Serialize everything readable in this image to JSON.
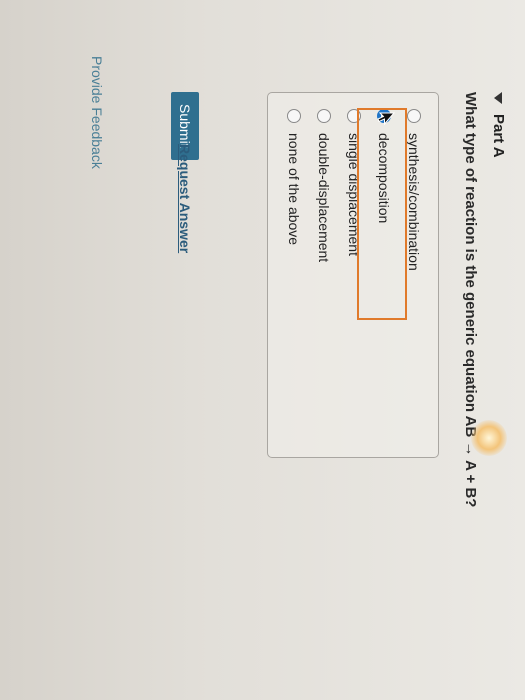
{
  "part": {
    "title": "Part A"
  },
  "question": {
    "text": "What type of reaction is the generic equation AB → A + B?"
  },
  "options": [
    {
      "label": "synthesis/combination",
      "selected": false
    },
    {
      "label": "decomposition",
      "selected": true
    },
    {
      "label": "single displacement",
      "selected": false
    },
    {
      "label": "double-displacement",
      "selected": false
    },
    {
      "label": "none of the above",
      "selected": false
    }
  ],
  "actions": {
    "submit_label": "Submit",
    "request_answer_label": "Request Answer"
  },
  "footer": {
    "feedback_label": "Provide Feedback"
  },
  "colors": {
    "accent": "#2f6f8f",
    "selected": "#1f75c8",
    "focus": "#e07a2b",
    "link": "#2b5c7c"
  }
}
